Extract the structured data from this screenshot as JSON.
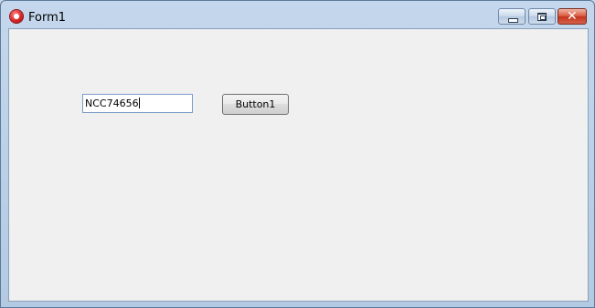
{
  "window": {
    "title": "Form1",
    "controls": {
      "minimize_icon": "minimize-icon",
      "maximize_icon": "maximize-icon",
      "close_icon": "close-icon",
      "close_glyph": "✕"
    }
  },
  "form": {
    "textbox_value": "NCC74656",
    "button_label": "Button1"
  },
  "colors": {
    "titlebar": "#c4d7ec",
    "client_background": "#f0f0f0",
    "close_button": "#c2341c"
  }
}
